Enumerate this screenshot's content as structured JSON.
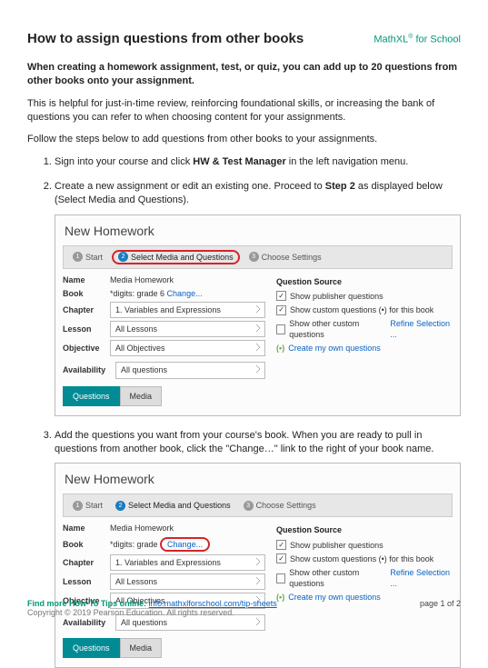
{
  "header": {
    "title": "How to assign questions from other books",
    "brand_prefix": "MathXL",
    "brand_suffix": " for School"
  },
  "intro": {
    "bold": "When creating a homework assignment, test, or quiz, you can add up to 20 questions from other books onto your assignment.",
    "p2": "This is helpful for just-in-time review, reinforcing foundational skills, or increasing the bank of questions you can refer to when choosing content for your assignments.",
    "p3": "Follow the steps below to add questions from other books to your assignments."
  },
  "steps": {
    "s1_a": "Sign into your course and click ",
    "s1_b": "HW & Test Manager",
    "s1_c": " in the left navigation menu.",
    "s2_a": "Create a new assignment or edit an existing one. Proceed to ",
    "s2_b": "Step 2",
    "s2_c": " as displayed below (Select Media and Questions).",
    "s3": "Add the questions you want from your course's book. When you are ready to pull in questions from another book, click the \"Change…\" link to the right of your book name."
  },
  "panel": {
    "title": "New Homework",
    "wz1": "Start",
    "wz2": "Select Media and Questions",
    "wz3": "Choose Settings",
    "labels": {
      "name": "Name",
      "book": "Book",
      "chapter": "Chapter",
      "lesson": "Lesson",
      "objective": "Objective",
      "availability": "Availability"
    },
    "values": {
      "name_val": "Media Homework",
      "book_a": "*digits: grade 6 ",
      "book_b": "*digits: grade ",
      "change": "Change...",
      "chapter_sel": "1. Variables and Expressions",
      "lesson_sel": "All Lessons",
      "objective_sel": "All Objectives",
      "avail_sel": "All questions"
    },
    "qs": {
      "heading": "Question Source",
      "c1": "Show publisher questions",
      "c2": "Show custom questions (•) for this book",
      "c3_a": "Show other custom questions ",
      "c3_link": "Refine Selection ...",
      "c4_a": "(•) ",
      "c4_link": "Create my own questions"
    },
    "tabs": {
      "t1": "Questions",
      "t2": "Media"
    }
  },
  "footer": {
    "lead": "Find more How-To Tips online: ",
    "link": "info.mathxlforschool.com/tip-sheets",
    "copy": "Copyright © 2019 Pearson Education. All rights reserved.",
    "page": "page 1 of 2"
  }
}
